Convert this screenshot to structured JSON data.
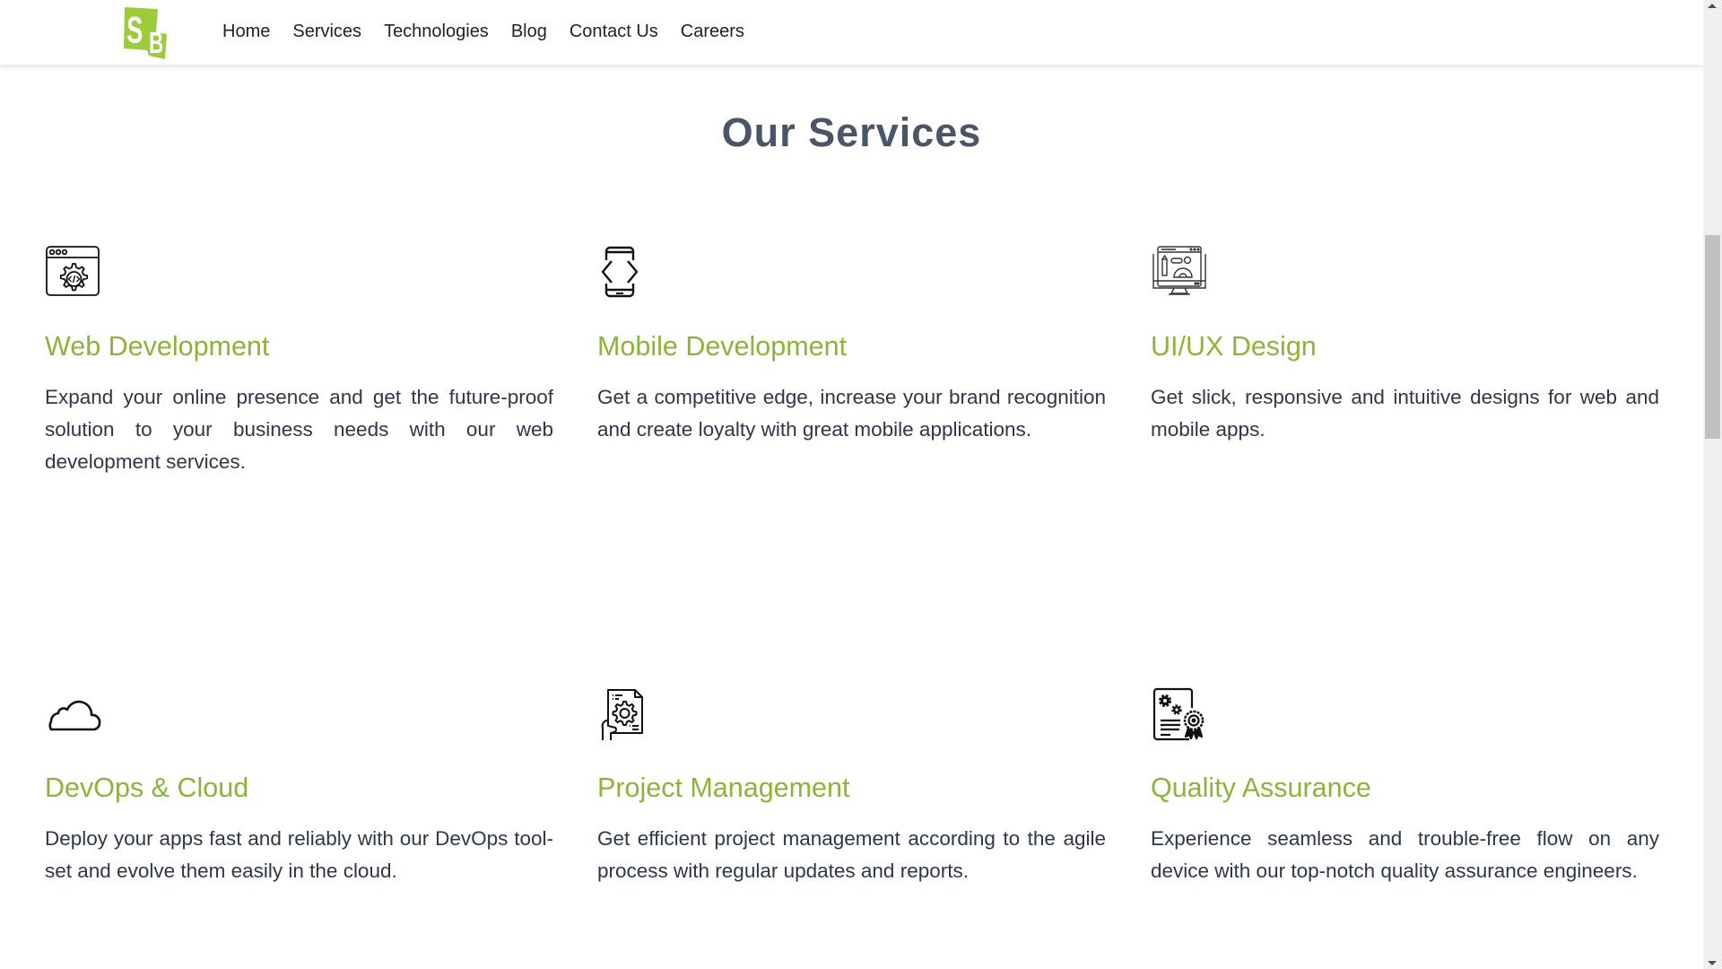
{
  "brand": {
    "logo_text": "SB",
    "logo_color": "#9ccc3c"
  },
  "nav": {
    "items": [
      {
        "label": "Home"
      },
      {
        "label": "Services"
      },
      {
        "label": "Technologies"
      },
      {
        "label": "Blog"
      },
      {
        "label": "Contact Us"
      },
      {
        "label": "Careers"
      }
    ]
  },
  "section": {
    "title": "Our Services",
    "title_color": "#4a5568",
    "accent_color": "#8db33a"
  },
  "services": [
    {
      "icon": "web-development-icon",
      "title": "Web Development",
      "description": "Expand your online presence and get the future-proof solution to your business needs with our web development services."
    },
    {
      "icon": "mobile-development-icon",
      "title": "Mobile Development",
      "description": "Get a competitive edge, increase your brand recognition and create loyalty with great mobile applications."
    },
    {
      "icon": "ui-ux-design-icon",
      "title": "UI/UX Design",
      "description": "Get slick, responsive and intuitive designs for web and mobile apps."
    },
    {
      "icon": "cloud-icon",
      "title": "DevOps & Cloud",
      "description": "Deploy your apps fast and reliably with our DevOps tool-set and evolve them easily in the cloud."
    },
    {
      "icon": "project-management-icon",
      "title": "Project Management",
      "description": "Get efficient project management according to the agile process with regular updates and reports."
    },
    {
      "icon": "quality-assurance-icon",
      "title": "Quality Assurance",
      "description": "Experience seamless and trouble-free flow on any device with our top-notch quality assurance engineers."
    }
  ],
  "scrollbar": {
    "position_fraction": 0.24
  }
}
